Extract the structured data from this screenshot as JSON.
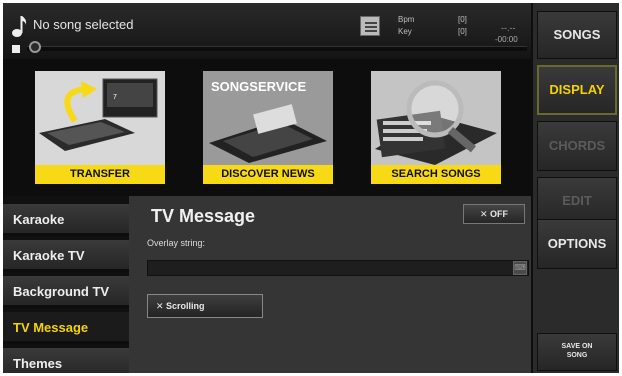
{
  "player": {
    "song_title": "No song selected",
    "bpm_label": "Bpm",
    "key_label": "Key",
    "bpm_value": "[0]",
    "key_value": "[0]",
    "time_dashes": "--.--",
    "time_value": "-00:00"
  },
  "right_menu": {
    "songs": "SONGS",
    "display": "DISPLAY",
    "chords": "CHORDS",
    "edit": "EDIT",
    "options": "OPTIONS",
    "save_line1": "SAVE ON",
    "save_line2": "SONG"
  },
  "banner": {
    "transfer": "TRANSFER",
    "discover": "DISCOVER NEWS",
    "search": "SEARCH SONGS",
    "service_logo": "SONGSERVICE"
  },
  "nav": {
    "items": [
      {
        "label": "Karaoke"
      },
      {
        "label": "Karaoke TV"
      },
      {
        "label": "Background TV"
      },
      {
        "label": "TV Message"
      },
      {
        "label": "Themes"
      }
    ],
    "active_index": 3
  },
  "panel": {
    "title": "TV Message",
    "off_label": "✕ OFF",
    "overlay_label": "Overlay string:",
    "overlay_value": "",
    "scrolling_label": "✕ Scrolling"
  },
  "colors": {
    "accent": "#f4d300",
    "banner_caption": "#f7d916"
  },
  "icons": {
    "music": "music-note-icon",
    "list": "playlist-icon",
    "keyboard": "keyboard-icon"
  }
}
